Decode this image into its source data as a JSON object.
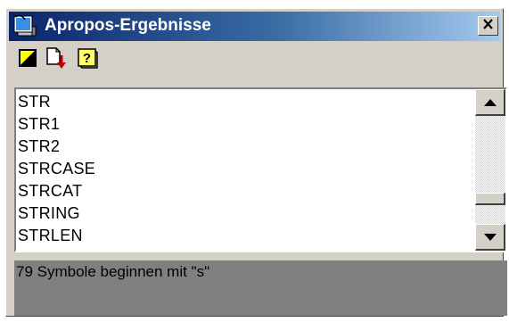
{
  "window": {
    "title": "Apropos-Ergebnisse",
    "close_label": "×"
  },
  "toolbar": {
    "buttons": [
      {
        "icon": "color-select-icon"
      },
      {
        "icon": "copy-down-icon"
      },
      {
        "icon": "help-icon"
      }
    ]
  },
  "results": {
    "items": [
      "STR",
      "STR1",
      "STR2",
      "STRCASE",
      "STRCAT",
      "STRING",
      "STRLEN"
    ]
  },
  "status": {
    "text": "79 Symbole beginnen mit \"s\""
  },
  "colors": {
    "titlebar_start": "#0a246a",
    "titlebar_end": "#a6caf0",
    "face": "#d4d0c8",
    "status_bg": "#808080"
  }
}
